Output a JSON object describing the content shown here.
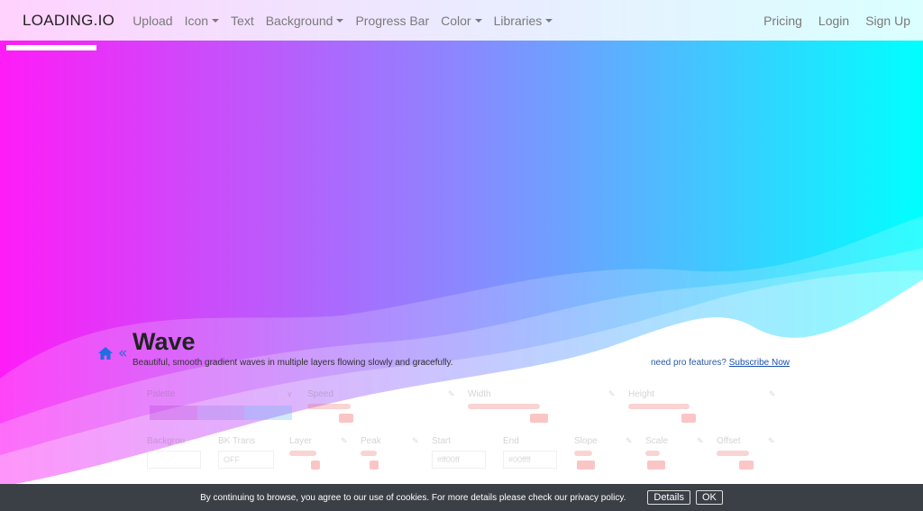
{
  "navbar": {
    "brand": "LOADING.IO",
    "items": [
      {
        "label": "Upload",
        "caret": false
      },
      {
        "label": "Icon",
        "caret": true
      },
      {
        "label": "Text",
        "caret": false
      },
      {
        "label": "Background",
        "caret": true
      },
      {
        "label": "Progress Bar",
        "caret": false
      },
      {
        "label": "Color",
        "caret": true
      },
      {
        "label": "Libraries",
        "caret": true
      }
    ],
    "right_items": [
      {
        "label": "Pricing"
      },
      {
        "label": "Login"
      },
      {
        "label": "Sign Up"
      }
    ]
  },
  "page": {
    "title": "Wave",
    "subtitle": "Beautiful, smooth gradient waves in multiple layers flowing slowly and gracefully.",
    "pro_prefix": "need pro features?",
    "pro_link": "Subscribe Now",
    "back_glyph": "«"
  },
  "colors": {
    "gradient_left": "#ff1cf7",
    "gradient_mid": "#8b87ff",
    "gradient_right": "#00ffff",
    "accent_blue": "#1e6fe0",
    "cookie_bg": "#3b3f46"
  },
  "panel": {
    "row1": [
      {
        "label": "Palette"
      },
      {
        "label": "Speed"
      },
      {
        "label": "Width"
      },
      {
        "label": "Height"
      }
    ],
    "row2": [
      {
        "label": "Backgrou"
      },
      {
        "label": "BK Trans"
      },
      {
        "label": "Layer"
      },
      {
        "label": "Peak"
      },
      {
        "label": "Start"
      },
      {
        "label": "End"
      },
      {
        "label": "Slope"
      },
      {
        "label": "Scale"
      },
      {
        "label": "Offset"
      }
    ],
    "start_value": "#ff00ff",
    "end_value": "#00ffff",
    "bk_trans_value": "OFF"
  },
  "cookie": {
    "text": "By continuing to browse, you agree to our use of cookies. For more details please check our privacy policy.",
    "details_label": "Details",
    "ok_label": "OK"
  }
}
